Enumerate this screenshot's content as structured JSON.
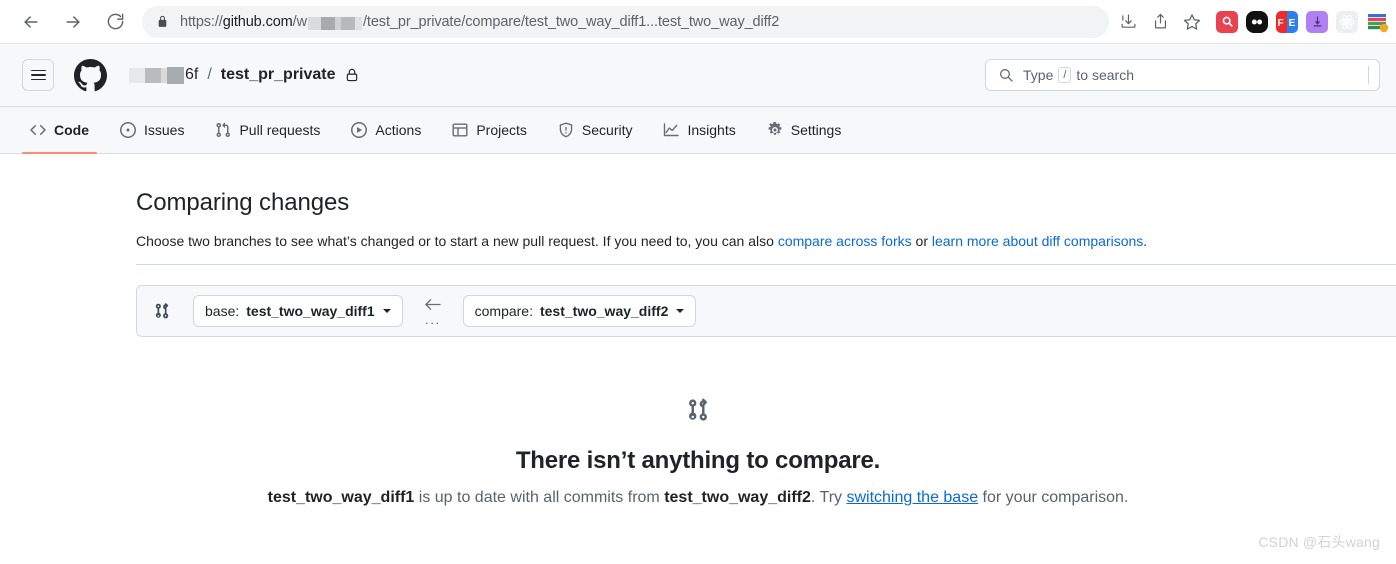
{
  "browser": {
    "back_label": "Back",
    "forward_label": "Forward",
    "reload_label": "Reload",
    "lock_icon": "lock-icon",
    "url_prefix": "https://github.com/w",
    "url_redacted": "████",
    "url_suffix": "/test_pr_private/compare/test_two_way_diff1...test_two_way_diff2",
    "url_host": "github.com",
    "url_scheme": "https://",
    "download_icon": "download-icon",
    "share_icon": "share-icon",
    "bookmark_icon": "star-icon",
    "extensions": [
      {
        "name": "search-extension-icon",
        "glyph": "⌕",
        "color": "#e8434f"
      },
      {
        "name": "dots-extension-icon",
        "glyph": "",
        "color": "#111111"
      },
      {
        "name": "fe-extension-icon",
        "glyph": "FE",
        "color": "#1a73e8"
      },
      {
        "name": "download-extension-icon",
        "glyph": "⬇",
        "color": "#b07ff0"
      },
      {
        "name": "react-extension-icon",
        "glyph": "",
        "color": "#eceef0"
      },
      {
        "name": "misc-extension-icon",
        "glyph": "",
        "color": "#ffffff"
      }
    ]
  },
  "gh_header": {
    "menu_label": "Open menu",
    "logo_label": "GitHub",
    "owner_redacted": "████",
    "owner_visible_tail": "6f",
    "separator": "/",
    "repo_name": "test_pr_private",
    "visibility": "Private",
    "search_placeholder_pre": "Type",
    "search_key": "/",
    "search_placeholder_post": "to search"
  },
  "repo_nav": {
    "tabs": [
      {
        "label": "Code",
        "icon": "code-icon",
        "active": true
      },
      {
        "label": "Issues",
        "icon": "issue-opened-icon",
        "active": false
      },
      {
        "label": "Pull requests",
        "icon": "git-pull-request-icon",
        "active": false
      },
      {
        "label": "Actions",
        "icon": "play-icon",
        "active": false
      },
      {
        "label": "Projects",
        "icon": "table-icon",
        "active": false
      },
      {
        "label": "Security",
        "icon": "shield-icon",
        "active": false
      },
      {
        "label": "Insights",
        "icon": "graph-icon",
        "active": false
      },
      {
        "label": "Settings",
        "icon": "gear-icon",
        "active": false
      }
    ],
    "active_underline_color": "#fd8c73"
  },
  "main": {
    "title": "Comparing changes",
    "description_part1": "Choose two branches to see what’s changed or to start a new pull request. If you need to, you can also ",
    "description_link1": "compare across forks",
    "description_mid": " or ",
    "description_link2": "learn more about diff comparisons",
    "description_end": ".",
    "branch_bar": {
      "compare_icon": "git-compare-icon",
      "base_prefix": "base:",
      "base_branch": "test_two_way_diff1",
      "arrow_icon": "arrow-left-icon",
      "ellipsis": "···",
      "compare_prefix": "compare:",
      "compare_branch": "test_two_way_diff2"
    },
    "empty_state": {
      "icon": "git-compare-icon",
      "title": "There isn’t anything to compare.",
      "branch_base": "test_two_way_diff1",
      "sentence_mid": " is up to date with all commits from ",
      "branch_compare": "test_two_way_diff2",
      "sentence_try": ". Try ",
      "link": "switching the base",
      "sentence_end": " for your comparison."
    }
  },
  "watermark": "CSDN @石头wang",
  "colors": {
    "accent_link": "#0969da",
    "active_tab": "#fd8c73",
    "header_bg": "#f6f8fa",
    "border": "#d1d9e0"
  }
}
